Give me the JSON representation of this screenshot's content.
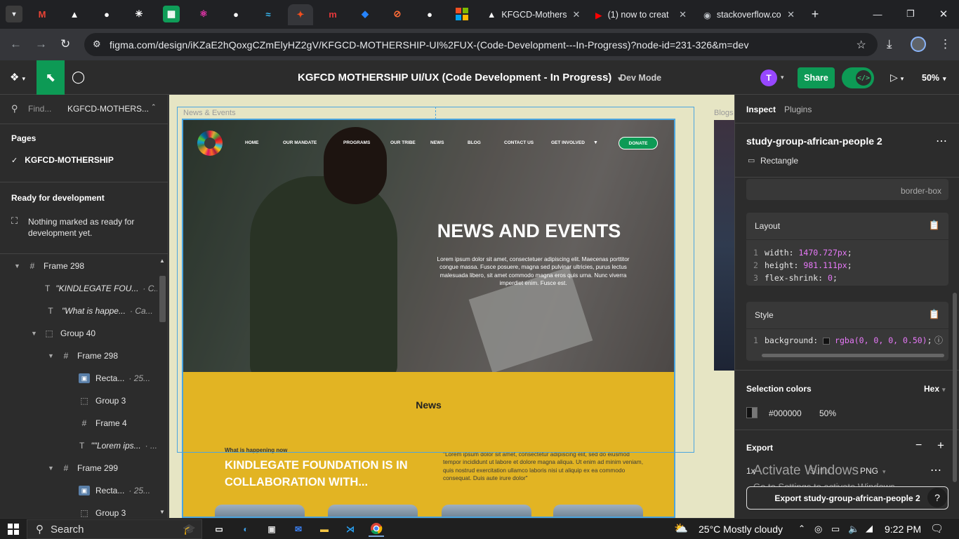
{
  "browser": {
    "tabs_icons": [
      "chevron-down-icon",
      "gmail-icon",
      "notion-icon",
      "github-icon",
      "chatgpt-icon",
      "sheets-icon",
      "react-icon",
      "github-icon",
      "tailwind-icon",
      "figma-icon",
      "mural-icon",
      "jira-icon",
      "postman-icon",
      "github-icon",
      "microsoft-icon"
    ],
    "tabs": [
      {
        "title": "KFGCD-Mothers"
      },
      {
        "title": "(1) now to creat"
      },
      {
        "title": "stackoverflow.co"
      }
    ],
    "url": "figma.com/design/iKZaE2hQoxgCZmElyHZ2gV/KFGCD-MOTHERSHIP-UI%2FUX-(Code-Development---In-Progress)?node-id=231-326&m=dev"
  },
  "figma": {
    "file_title": "KGFCD MOTHERSHIP UI/UX (Code Development - In Progress)",
    "dev_mode_label": "Dev Mode",
    "avatar_letter": "T",
    "share_label": "Share",
    "zoom": "50%",
    "left": {
      "find_placeholder": "Find...",
      "file_short": "KGFCD-MOTHERS...",
      "pages_heading": "Pages",
      "current_page": "KGFCD-MOTHERSHIP",
      "ready_heading": "Ready for development",
      "ready_message": "Nothing marked as ready for development yet.",
      "layers": [
        {
          "name": "Frame 298",
          "meta": ""
        },
        {
          "name": "\"KINDLEGATE FOU...",
          "meta": "· C..."
        },
        {
          "name": "\"What is happe...",
          "meta": "· Ca..."
        },
        {
          "name": "Group 40",
          "meta": ""
        },
        {
          "name": "Frame 298",
          "meta": ""
        },
        {
          "name": "Recta...",
          "meta": "· 25..."
        },
        {
          "name": "Group 3",
          "meta": ""
        },
        {
          "name": "Frame 4",
          "meta": ""
        },
        {
          "name": "\"\"Lorem ips...",
          "meta": "· ..."
        },
        {
          "name": "Frame 299",
          "meta": ""
        },
        {
          "name": "Recta...",
          "meta": "· 25..."
        },
        {
          "name": "Group 3",
          "meta": ""
        }
      ]
    },
    "canvas": {
      "frame_label": "News & Events",
      "blogs_label": "Blogs",
      "nav": [
        "HOME",
        "OUR MANDATE",
        "PROGRAMS",
        "OUR TRIBE",
        "NEWS",
        "BLOG",
        "CONTACT US",
        "GET INVOLVED"
      ],
      "donate_label": "DONATE",
      "hero_title": "NEWS AND EVENTS",
      "hero_body": "Lorem ipsum dolor sit amet, consectetuer adipiscing elit. Maecenas porttitor congue massa. Fusce posuere, magna sed pulvinar ultricies, purus lectus malesuada libero, sit amet commodo magna eros quis urna. Nunc viverra imperdiet enim. Fusce est.",
      "news_heading": "News",
      "news_kicker": "What is happening now",
      "news_title": "KINDLEGATE FOUNDATION IS IN COLLABORATION WITH...",
      "news_quote": "\"Lorem ipsum dolor sit amet, consectetur adipiscing elit, sed do eiusmod tempor incididunt ut labore et dolore magna aliqua. Ut enim ad minim veniam, quis nostrud exercitation ullamco laboris nisi ut aliquip ex ea commodo consequat. Duis aute irure dolor\""
    },
    "right": {
      "tab_inspect": "Inspect",
      "tab_plugins": "Plugins",
      "layer_name": "study-group-african-people 2",
      "layer_type": "Rectangle",
      "box_sizing": "border-box",
      "layout_heading": "Layout",
      "layout_code": [
        {
          "n": "1",
          "prop": "width",
          "val": "1470.727px"
        },
        {
          "n": "2",
          "prop": "height",
          "val": "981.111px"
        },
        {
          "n": "3",
          "prop": "flex-shrink",
          "val": "0"
        }
      ],
      "style_heading": "Style",
      "style_code": {
        "n": "1",
        "prop": "background",
        "val": "rgba(0, 0, 0, 0.50)"
      },
      "selection_heading": "Selection colors",
      "color_format": "Hex",
      "selection_hex": "#000000",
      "selection_opacity": "50%",
      "export_heading": "Export",
      "export_scale": "1x",
      "export_suffix": "Suffix",
      "export_format": "PNG",
      "export_button": "Export study-group-african-people 2",
      "watermark_title": "Activate Windows",
      "watermark_sub": "Go to Settings to activate Windows."
    }
  },
  "taskbar": {
    "search": "Search",
    "weather": "25°C  Mostly cloudy",
    "time": "9:22 PM"
  },
  "colors": {
    "accent_share": "#0d9a55",
    "selection_blue": "#4aa5e0",
    "news_yellow": "#e2b423",
    "avatar_purple": "#9747ff"
  }
}
